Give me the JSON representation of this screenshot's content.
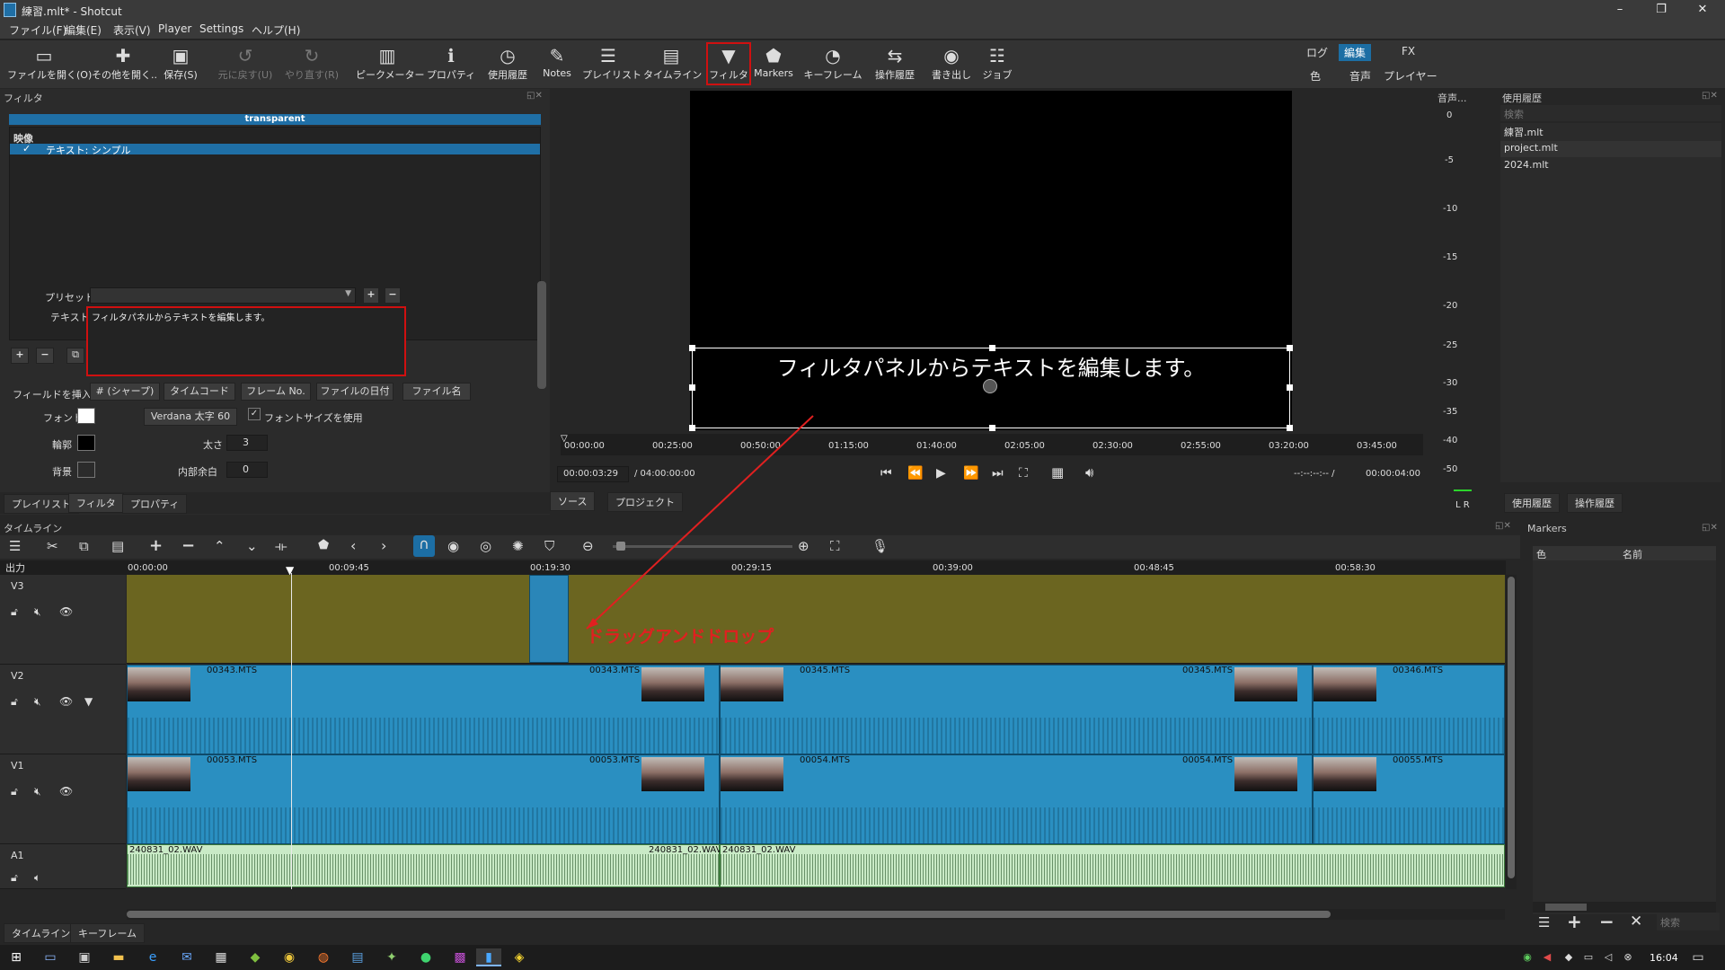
{
  "window": {
    "title": "練習.mlt* - Shotcut",
    "min": "–",
    "max": "❐",
    "close": "✕"
  },
  "menu": [
    "ファイル(F)",
    "編集(E)",
    "表示(V)",
    "Player",
    "Settings",
    "ヘルプ(H)"
  ],
  "toolbar": [
    {
      "label": "ファイルを開く(O)",
      "icon": "open-file-icon"
    },
    {
      "label": "その他を開く..",
      "icon": "open-other-icon"
    },
    {
      "label": "保存(S)",
      "icon": "save-icon"
    },
    {
      "label": "元に戻す(U)",
      "icon": "undo-icon"
    },
    {
      "label": "やり直す(R)",
      "icon": "redo-icon"
    },
    {
      "label": "ピークメーター",
      "icon": "peak-meter-icon"
    },
    {
      "label": "プロパティ",
      "icon": "properties-icon"
    },
    {
      "label": "使用履歴",
      "icon": "history-clock-icon"
    },
    {
      "label": "Notes",
      "icon": "notes-icon"
    },
    {
      "label": "プレイリスト",
      "icon": "playlist-icon"
    },
    {
      "label": "タイムライン",
      "icon": "timeline-icon"
    },
    {
      "label": "フィルタ",
      "icon": "filter-funnel-icon"
    },
    {
      "label": "Markers",
      "icon": "markers-icon"
    },
    {
      "label": "キーフレーム",
      "icon": "keyframes-icon"
    },
    {
      "label": "操作履歴",
      "icon": "undo-history-icon"
    },
    {
      "label": "書き出し",
      "icon": "export-icon"
    },
    {
      "label": "ジョブ",
      "icon": "jobs-icon"
    }
  ],
  "layouts": {
    "row1": [
      "ログ",
      "編集",
      "FX"
    ],
    "row2": [
      "色",
      "音声",
      "プレイヤー"
    ],
    "active": "編集"
  },
  "filters": {
    "title": "フィルタ",
    "clip_name": "transparent",
    "category": "映像",
    "item_check": "✓",
    "item": "テキスト: シンプル",
    "preset_label": "プリセット",
    "text_label": "テキスト",
    "text_value": "フィルタパネルからテキストを編集します。",
    "insert_label": "フィールドを挿入",
    "insert_buttons": [
      "# (シャープ)",
      "タイムコード",
      "フレーム No.",
      "ファイルの日付",
      "ファイル名"
    ],
    "font_label": "フォント",
    "font_button": "Verdana 太字 60",
    "font_size_check": "✓",
    "font_size_label": "フォントサイズを使用",
    "outline_label": "輪郭",
    "thickness_label": "太さ",
    "thickness_value": "3",
    "bg_label": "背景",
    "padding_label": "内部余白",
    "padding_value": "0"
  },
  "left_tabs": [
    "プレイリスト",
    "フィルタ",
    "プロパティ"
  ],
  "player": {
    "overlay_text": "フィルタパネルからテキストを編集します。",
    "ruler": [
      "00:00:00",
      "00:25:00",
      "00:50:00",
      "01:15:00",
      "01:40:00",
      "02:05:00",
      "02:30:00",
      "02:55:00",
      "03:20:00",
      "03:45:00"
    ],
    "timecode": "00:00:03:29",
    "duration": "/ 04:00:00:00",
    "inout": "--:--:--:-- /",
    "end": "00:00:04:00",
    "tabs": [
      "ソース",
      "プロジェクト"
    ]
  },
  "audio_meter": {
    "title": "音声...",
    "scale": [
      "0",
      "-5",
      "-10",
      "-15",
      "-20",
      "-25",
      "-30",
      "-35",
      "-40",
      "-50"
    ],
    "lr": "L R"
  },
  "recent": {
    "title": "使用履歴",
    "search": "検索",
    "items": [
      "練習.mlt",
      "project.mlt",
      "2024.mlt"
    ],
    "tabs": [
      "使用履歴",
      "操作履歴"
    ]
  },
  "timeline": {
    "title": "タイムライン",
    "output": "出力",
    "ruler": [
      "00:00:00",
      "00:09:45",
      "00:19:30",
      "00:29:15",
      "00:39:00",
      "00:48:45",
      "00:58:30"
    ],
    "tracks": [
      "V3",
      "V2",
      "V1",
      "A1"
    ],
    "annotation": "ドラッグアンドドロップ",
    "v2_clips": [
      "00343.MTS",
      "00343.MTS",
      "00345.MTS",
      "00345.MTS",
      "00346.MTS"
    ],
    "v1_clips": [
      "00053.MTS",
      "00053.MTS",
      "00054.MTS",
      "00054.MTS",
      "00055.MTS"
    ],
    "a1_clips": [
      "240831_02.WAV",
      "240831_02.WAV",
      "240831_02.WAV"
    ]
  },
  "markers": {
    "title": "Markers",
    "col_color": "色",
    "col_name": "名前",
    "search": "検索"
  },
  "bottom_tabs": [
    "タイムライン",
    "キーフレーム"
  ],
  "clock": "16:04"
}
